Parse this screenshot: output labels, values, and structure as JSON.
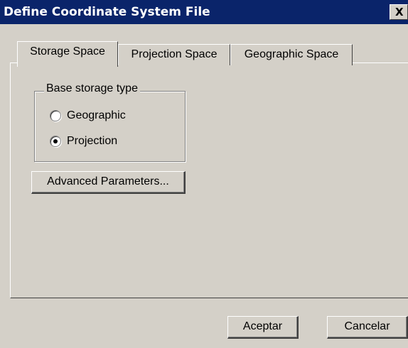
{
  "window": {
    "title": "Define Coordinate System File",
    "close_glyph": "X"
  },
  "tabs": [
    {
      "label": "Storage Space",
      "active": true
    },
    {
      "label": "Projection Space",
      "active": false
    },
    {
      "label": "Geographic Space",
      "active": false
    }
  ],
  "storage": {
    "group_label": "Base storage type",
    "options": [
      {
        "label": "Geographic",
        "checked": false
      },
      {
        "label": "Projection",
        "checked": true
      }
    ],
    "advanced_button": "Advanced Parameters..."
  },
  "footer": {
    "ok_label": "Aceptar",
    "cancel_label": "Cancelar"
  },
  "icons": [
    "close-icon",
    "radio-unchecked-icon",
    "radio-checked-icon"
  ]
}
